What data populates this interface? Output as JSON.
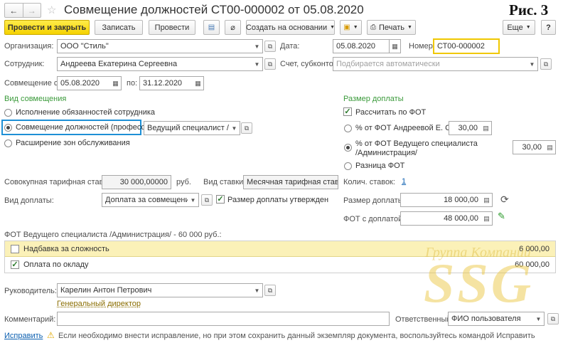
{
  "header": {
    "title": "Совмещение должностей СТ00-000002 от 05.08.2020",
    "figure_label": "Рис. 3"
  },
  "toolbar": {
    "post_close": "Провести и закрыть",
    "save": "Записать",
    "post": "Провести",
    "create_based": "Создать на основании",
    "print": "Печать",
    "more": "Еще",
    "help": "?"
  },
  "form": {
    "organization_label": "Организация:",
    "organization_value": "ООО \"Стиль\"",
    "date_label": "Дата:",
    "date_value": "05.08.2020",
    "number_label": "Номер:",
    "number_value": "СТ00-000002",
    "employee_label": "Сотрудник:",
    "employee_value": "Андреева Екатерина Сергеевна",
    "account_label": "Счет, субконто:",
    "account_placeholder": "Подбирается автоматически",
    "period_from_label": "Совмещение с:",
    "period_from_value": "05.08.2020",
    "period_to_label": "по:",
    "period_to_value": "31.12.2020"
  },
  "combination": {
    "section_title": "Вид совмещения",
    "options": [
      "Исполнение обязанностей сотрудника",
      "Совмещение должностей (профессий)",
      "Расширение зон обслуживания"
    ],
    "selected": 1,
    "position_value": "Ведущий специалист /Ад"
  },
  "surcharge": {
    "section_title": "Размер доплаты",
    "calc_by_fot": "Рассчитать по ФОТ",
    "percent_employee_label": "% от ФОТ Андреевой Е. С.",
    "percent_employee_value": "30,00",
    "percent_position_label_1": "% от ФОТ Ведущего специалиста",
    "percent_position_label_2": "/Администрация/",
    "percent_position_value": "30,00",
    "fot_difference": "Разница ФОТ",
    "rates_count_label": "Колич. ставок:",
    "rates_count_value": "1",
    "amount_label": "Размер доплаты:",
    "amount_value": "18 000,00",
    "fot_with_label": "ФОТ с доплатой:",
    "fot_with_value": "48 000,00"
  },
  "tariff": {
    "total_label": "Совокупная тарифная ставка:",
    "total_value": "30 000,00000",
    "currency": "руб.",
    "rate_type_label": "Вид ставки:",
    "rate_type_value": "Месячная тарифная ставка",
    "kind_label": "Вид доплаты:",
    "kind_value": "Доплата за совмещение д",
    "approved_label": "Размер доплаты утвержден"
  },
  "fot_table": {
    "caption": "ФОТ Ведущего специалиста /Администрация/ - 60 000 руб.:",
    "rows": [
      {
        "name": "Надбавка за сложность",
        "value": "6 000,00",
        "checked": false
      },
      {
        "name": "Оплата по окладу",
        "value": "60 000,00",
        "checked": true
      }
    ]
  },
  "footer": {
    "manager_label": "Руководитель:",
    "manager_value": "Карелин Антон Петрович",
    "manager_position": "Генеральный директор",
    "comment_label": "Комментарий:",
    "responsible_label": "Ответственный:",
    "responsible_value": "ФИО пользователя",
    "fix_link": "Исправить",
    "warning_text": "Если необходимо внести исправление, но при этом сохранить данный экземпляр документа, воспользуйтесь командой Исправить"
  },
  "watermark": {
    "line1": "Группа Компаний",
    "line2": "SSG"
  },
  "colors": {
    "primary_button": "#f5d200",
    "section_green": "#3a9a3a",
    "selection_blue": "#1e90d6",
    "link_blue": "#0b5fb0",
    "table_highlight": "#fbf1b8"
  }
}
